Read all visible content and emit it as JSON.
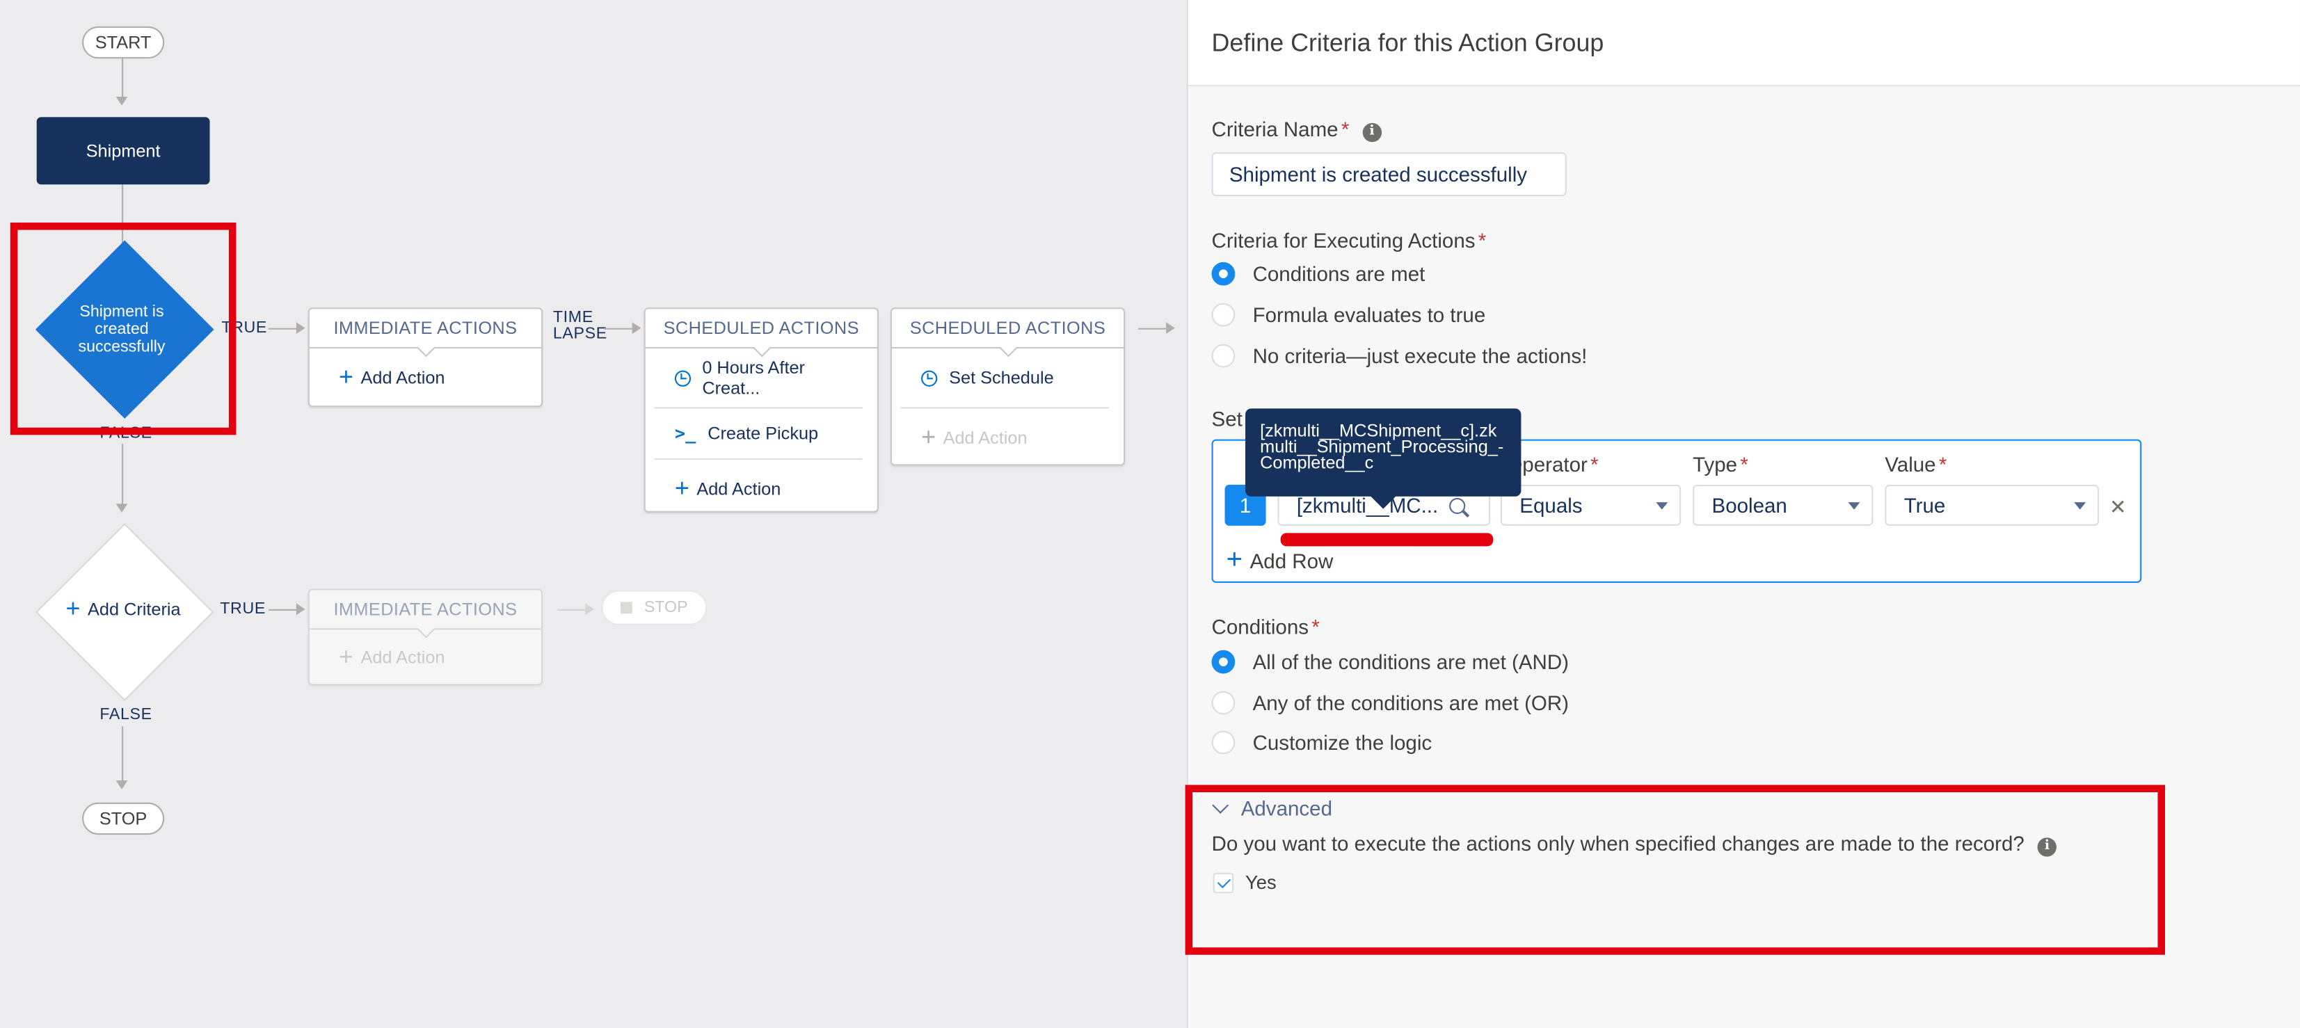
{
  "flow": {
    "start_label": "START",
    "object_label": "Shipment",
    "criteria_node_label": "Shipment is created successfully",
    "true_label": "TRUE",
    "false_label": "FALSE",
    "time_lapse_label": "TIME LAPSE",
    "add_criteria_label": "Add Criteria",
    "stop_label": "STOP",
    "immediate_header": "IMMEDIATE ACTIONS",
    "scheduled_header": "SCHEDULED ACTIONS",
    "add_action": "Add Action",
    "scheduled1_schedule": "0 Hours After Creat...",
    "scheduled1_action": "Create Pickup",
    "scheduled2_schedule": "Set Schedule"
  },
  "panel": {
    "title": "Define Criteria for this Action Group",
    "criteria_name_label": "Criteria Name",
    "criteria_name_value": "Shipment is created successfully",
    "executing_label": "Criteria for Executing Actions",
    "executing_options": [
      {
        "label": "Conditions are met",
        "selected": true
      },
      {
        "label": "Formula evaluates to true",
        "selected": false
      },
      {
        "label": "No criteria—just execute the actions!",
        "selected": false
      }
    ],
    "set_conditions_label": "Set",
    "condition": {
      "operator_label": "Operator",
      "type_label": "Type",
      "value_label": "Value",
      "row_number": "1",
      "field_value": "[zkmulti__MC...",
      "operator_value": "Equals",
      "type_value": "Boolean",
      "value_value": "True",
      "remove_glyph": "✕",
      "add_row": "Add Row",
      "tooltip": [
        "[zkmulti__MCShipment__c].zk",
        "multi__Shipment_Processing_-",
        "Completed__c"
      ]
    },
    "conditions_label": "Conditions",
    "conditions_options": [
      {
        "label": "All of the conditions are met (AND)",
        "selected": true
      },
      {
        "label": "Any of the conditions are met (OR)",
        "selected": false
      },
      {
        "label": "Customize the logic",
        "selected": false
      }
    ],
    "advanced_label": "Advanced",
    "advanced_question": "Do you want to execute the actions only when specified changes are made to the record?",
    "yes_label": "Yes",
    "yes_checked": true
  },
  "colors": {
    "accent": "#1589ee",
    "brand_dark": "#16325c",
    "highlight_red": "#e3000f"
  }
}
